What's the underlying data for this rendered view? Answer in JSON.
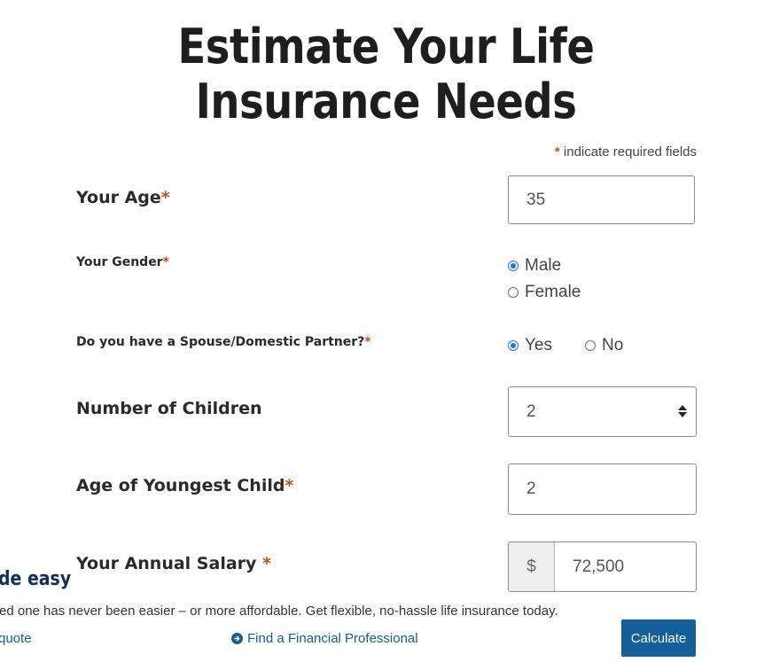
{
  "page": {
    "title": "Estimate Your Life Insurance Needs",
    "required_note": "indicate required fields",
    "required_star": "*"
  },
  "form": {
    "age": {
      "label": "Your Age",
      "value": "35"
    },
    "gender": {
      "label": "Your Gender",
      "options": [
        {
          "label": "Male",
          "checked": true
        },
        {
          "label": "Female",
          "checked": false
        }
      ]
    },
    "spouse": {
      "label": "Do you have a Spouse/Domestic Partner?",
      "options": [
        {
          "label": "Yes",
          "checked": true
        },
        {
          "label": "No",
          "checked": false
        }
      ]
    },
    "children": {
      "label": "Number of Children",
      "selected": "2"
    },
    "youngest": {
      "label": "Age of Youngest Child",
      "value": "2"
    },
    "salary": {
      "label": "Your Annual Salary",
      "prefix": "$",
      "value": "72,500"
    }
  },
  "banner": {
    "title": "de easy",
    "text": "ed one has never been easier – or more affordable. Get flexible, no-hassle life insurance today.",
    "link_quote": "quote",
    "link_professional": "Find a Financial Professional",
    "calculate_label": "Calculate"
  },
  "colors": {
    "accent": "#145f9c",
    "required_star": "#b3541e",
    "radio_checked": "#1a73e8"
  }
}
